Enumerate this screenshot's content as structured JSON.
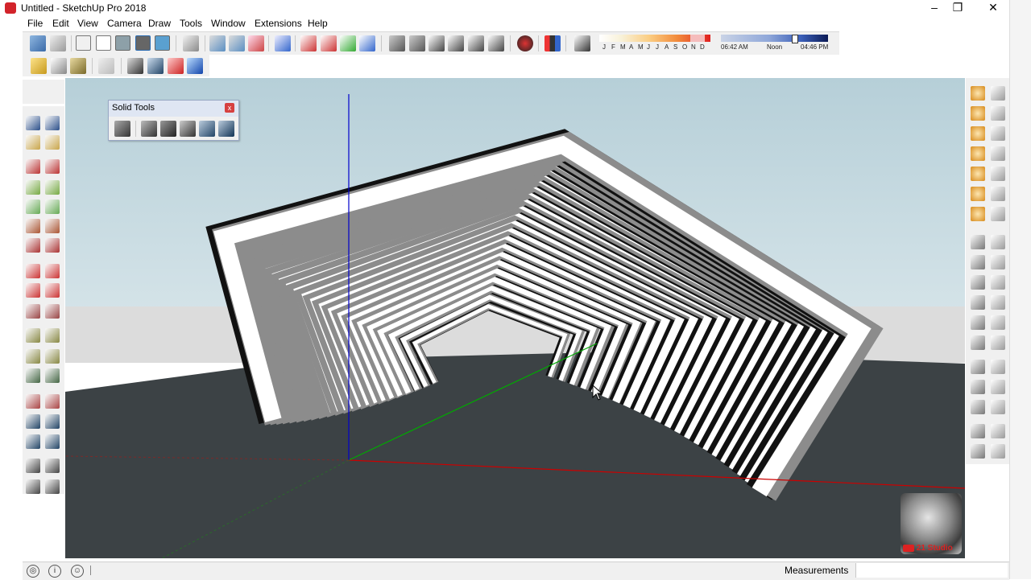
{
  "window": {
    "title": "Untitled - SketchUp Pro 2018",
    "minimize": "–",
    "restore": "❐",
    "close": "✕"
  },
  "menu": [
    "File",
    "Edit",
    "View",
    "Camera",
    "Draw",
    "Tools",
    "Window",
    "Extensions",
    "Help"
  ],
  "shadow": {
    "months": [
      "J",
      "F",
      "M",
      "A",
      "M",
      "J",
      "J",
      "A",
      "S",
      "O",
      "N",
      "D"
    ],
    "start_time": "06:42 AM",
    "mid_time": "Noon",
    "end_time": "04:46 PM"
  },
  "solid_tools": {
    "title": "Solid Tools",
    "close": "x",
    "icons": [
      "outer-shell-icon",
      "intersect-icon",
      "union-icon",
      "subtract-icon",
      "trim-icon",
      "split-icon"
    ]
  },
  "watermark": {
    "brand": "21 Studio"
  },
  "status": {
    "measurements_label": "Measurements",
    "measurements_value": ""
  },
  "colors": {
    "sky": "#c8dbe2",
    "horizon": "#dcdcdc",
    "ground": "#3c4245",
    "red_axis": "#cc0000",
    "green_axis": "#00aa00",
    "blue_axis": "#0000cc"
  }
}
